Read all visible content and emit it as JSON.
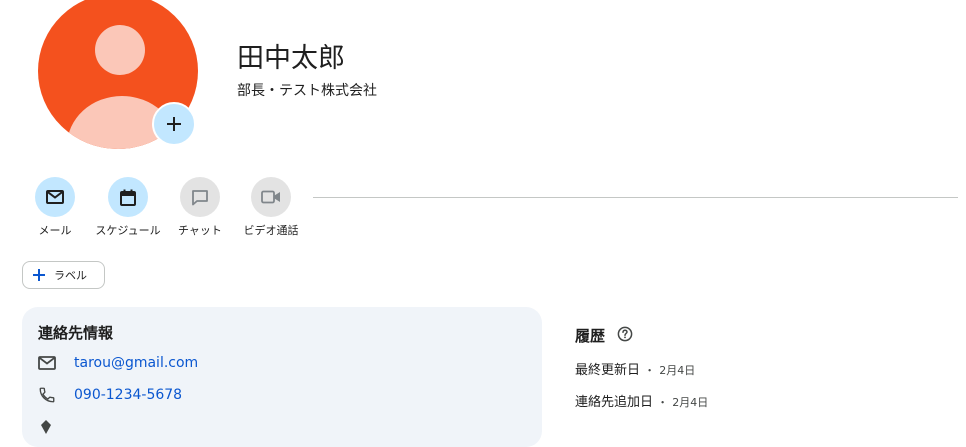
{
  "contact": {
    "name": "田中太郎",
    "subtitle": "部長・テスト株式会社"
  },
  "avatar": {
    "background": "#f4511e",
    "figure_color": "#fbc7b8",
    "add_button_color": "#c2e7ff",
    "add_icon": "plus-icon"
  },
  "actions": [
    {
      "label": "メール",
      "icon": "mail-icon",
      "enabled": true
    },
    {
      "label": "スケジュール",
      "icon": "calendar-icon",
      "enabled": true
    },
    {
      "label": "チャット",
      "icon": "chat-icon",
      "enabled": false
    },
    {
      "label": "ビデオ通話",
      "icon": "videocam-icon",
      "enabled": false
    }
  ],
  "label_button": {
    "label": "ラベル",
    "icon": "plus-icon"
  },
  "contact_info": {
    "title": "連絡先情報",
    "email": "tarou@gmail.com",
    "phone": "090-1234-5678"
  },
  "history": {
    "title": "履歴",
    "help_icon": "help-circle-icon",
    "last_updated_label": "最終更新日",
    "last_updated_date": "2月4日",
    "added_label": "連絡先追加日",
    "added_date": "2月4日",
    "separator": "・"
  },
  "colors": {
    "active_action_bg": "#c2e7ff",
    "disabled_action_bg": "#e3e3e3",
    "link": "#0b57d0",
    "card_bg": "#f0f4f9"
  }
}
